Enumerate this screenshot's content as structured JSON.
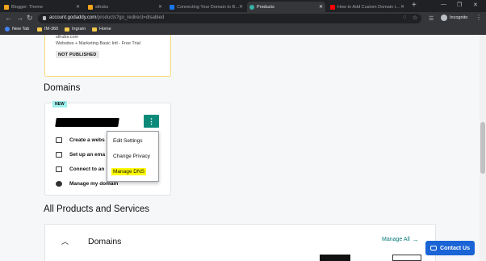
{
  "browser": {
    "tabs": [
      {
        "title": "Blogger: Theme",
        "icon_color": "#f4a41d",
        "active": false
      },
      {
        "title": "sthubs",
        "icon_color": "#f4a41d",
        "active": false
      },
      {
        "title": "Connecting Your Domain to B…",
        "icon_color": "#1a73e8",
        "active": false
      },
      {
        "title": "Products",
        "icon_color": "#37b3a6",
        "active": true
      },
      {
        "title": "How to Add Custom Domain t…",
        "icon_color": "#ff0000",
        "active": false
      }
    ],
    "url_host": "account.godaddy.com",
    "url_path": "/products?go_redirect=disabled",
    "profile_label": "Incognito",
    "bookmarks": [
      {
        "label": "New Tab",
        "icon": "google-icon"
      },
      {
        "label": "IM-360",
        "icon": "folder-icon"
      },
      {
        "label": "Ingram",
        "icon": "folder-icon"
      },
      {
        "label": "Home",
        "icon": "folder-icon"
      }
    ]
  },
  "top_card": {
    "site": "sthubs.com",
    "plan": "Websites + Marketing Basic Intl - Free Trial",
    "status": "NOT PUBLISHED"
  },
  "domains_section": {
    "heading": "Domains",
    "badge": "NEW",
    "kebab_glyph": "⋮",
    "rows": [
      {
        "label": "Create a webs",
        "icon": "browser-window-icon"
      },
      {
        "label": "Set up an ema",
        "icon": "email-icon"
      },
      {
        "label": "Connect to an",
        "icon": "connect-icon"
      },
      {
        "label": "Manage my domain",
        "icon": "globe-icon"
      }
    ],
    "menu": [
      {
        "label": "Edit Settings",
        "highlighted": false
      },
      {
        "label": "Change Privacy",
        "highlighted": false
      },
      {
        "label": "Manage DNS",
        "highlighted": true
      }
    ]
  },
  "all_products": {
    "heading": "All Products and Services",
    "group_title": "Domains",
    "manage_all": "Manage All"
  },
  "contact": {
    "label": "Contact Us"
  },
  "colors": {
    "teal": "#0b8a7a",
    "badge": "#9ef0ee",
    "highlight": "#fffb00",
    "contact": "#1a64d6"
  }
}
